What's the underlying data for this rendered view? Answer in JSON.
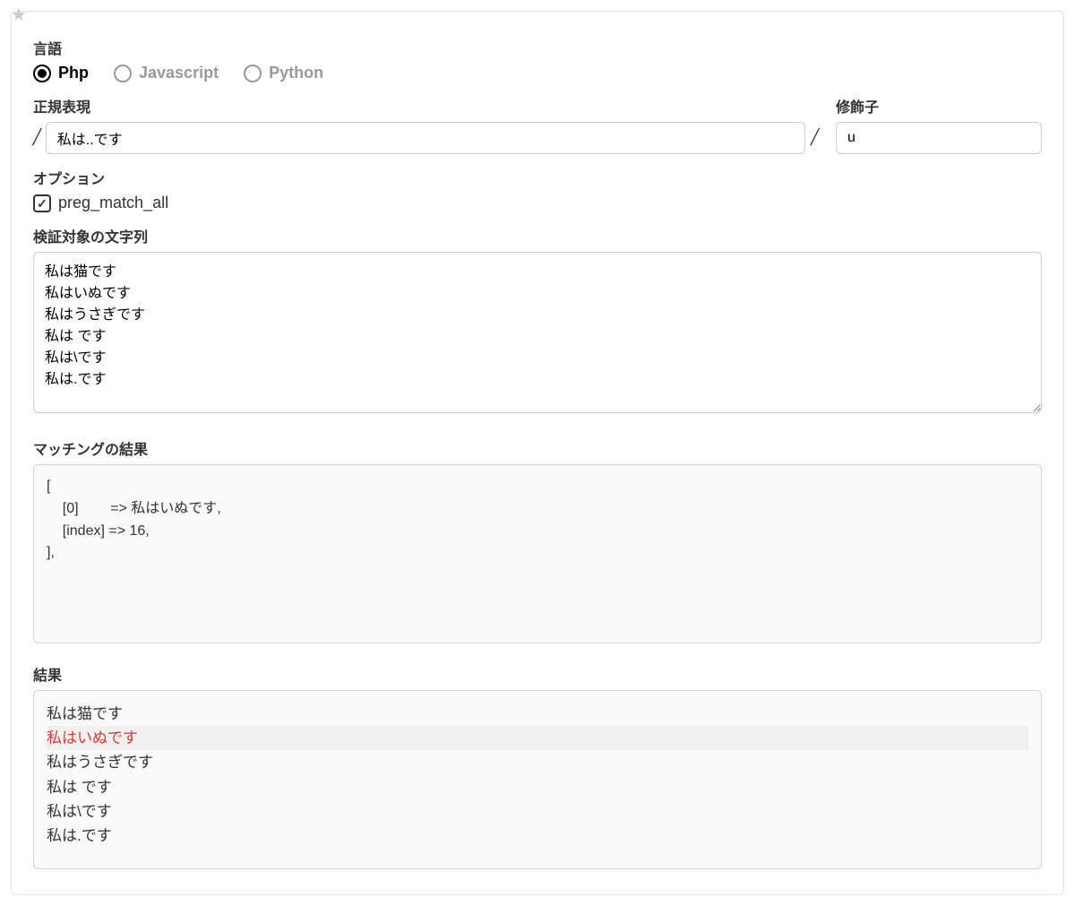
{
  "star_icon": "★",
  "language": {
    "label": "言語",
    "options": [
      {
        "id": "php",
        "label": "Php",
        "selected": true
      },
      {
        "id": "javascript",
        "label": "Javascript",
        "selected": false
      },
      {
        "id": "python",
        "label": "Python",
        "selected": false
      }
    ]
  },
  "regex": {
    "label": "正規表現",
    "value": "私は..です",
    "slash": "/"
  },
  "modifier": {
    "label": "修飾子",
    "value": "u"
  },
  "options": {
    "label": "オプション",
    "preg_match_all": {
      "label": "preg_match_all",
      "checked": true,
      "checkmark": "✓"
    }
  },
  "test_string": {
    "label": "検証対象の文字列",
    "value": "私は猫です\n私はいぬです\n私はうさぎです\n私は です\n私は\\です\n私は.です"
  },
  "matching_result": {
    "label": "マッチングの結果",
    "content": "[\n    [0]        => 私はいぬです,\n    [index] => 16,\n],"
  },
  "final_result": {
    "label": "結果",
    "lines": [
      {
        "text": "私は猫です",
        "highlighted": false
      },
      {
        "text": "私はいぬです",
        "highlighted": true
      },
      {
        "text": "私はうさぎです",
        "highlighted": false
      },
      {
        "text": "私は です",
        "highlighted": false
      },
      {
        "text": "私は\\です",
        "highlighted": false
      },
      {
        "text": "私は.です",
        "highlighted": false
      }
    ]
  }
}
